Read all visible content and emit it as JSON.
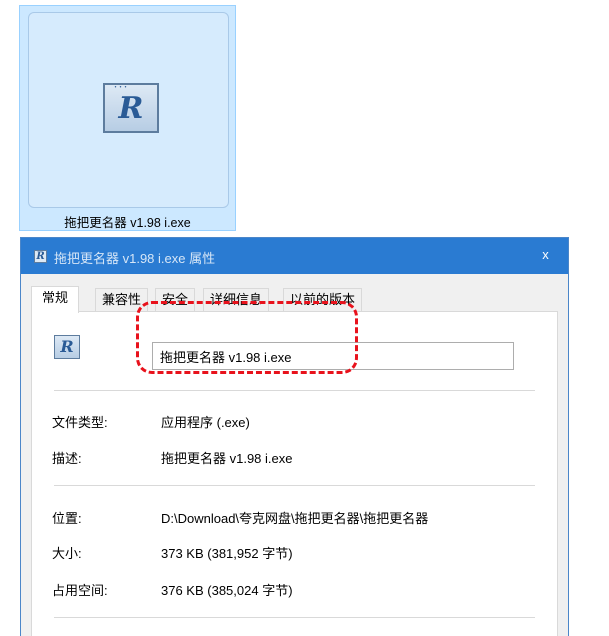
{
  "explorer": {
    "file_name": "拖把更名器 v1.98 i.exe",
    "icon": "app-r-icon"
  },
  "dialog": {
    "title": "拖把更名器 v1.98 i.exe 属性",
    "close_label": "x",
    "tabs": [
      {
        "label": "常规",
        "active": true
      },
      {
        "label": "兼容性",
        "active": false
      },
      {
        "label": "安全",
        "active": false
      },
      {
        "label": "详细信息",
        "active": false
      },
      {
        "label": "以前的版本",
        "active": false
      }
    ],
    "general": {
      "name_value": "拖把更名器 v1.98 i.exe",
      "file_type_label": "文件类型:",
      "file_type_value": "应用程序 (.exe)",
      "description_label": "描述:",
      "description_value": "拖把更名器 v1.98 i.exe",
      "location_label": "位置:",
      "location_value": "D:\\Download\\夸克网盘\\拖把更名器\\拖把更名器",
      "size_label": "大小:",
      "size_value": "373 KB (381,952 字节)",
      "size_on_disk_label": "占用空间:",
      "size_on_disk_value": "376 KB (385,024 字节)"
    }
  },
  "colors": {
    "titlebar": "#2a7bd2",
    "selection_bg": "#cce8ff",
    "annotation": "#e8121c"
  }
}
